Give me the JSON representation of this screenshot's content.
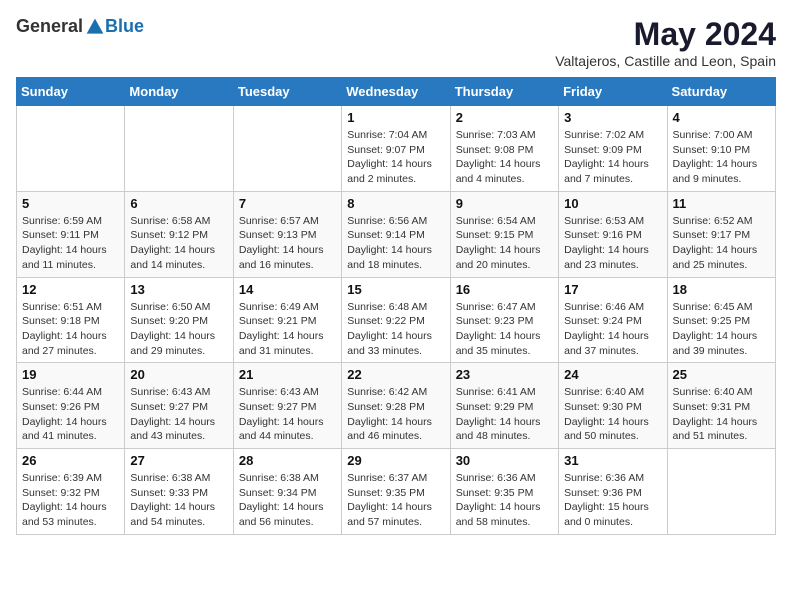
{
  "header": {
    "logo_general": "General",
    "logo_blue": "Blue",
    "month_year": "May 2024",
    "location": "Valtajeros, Castille and Leon, Spain"
  },
  "days_of_week": [
    "Sunday",
    "Monday",
    "Tuesday",
    "Wednesday",
    "Thursday",
    "Friday",
    "Saturday"
  ],
  "weeks": [
    [
      {
        "day": "",
        "info": ""
      },
      {
        "day": "",
        "info": ""
      },
      {
        "day": "",
        "info": ""
      },
      {
        "day": "1",
        "info": "Sunrise: 7:04 AM\nSunset: 9:07 PM\nDaylight: 14 hours\nand 2 minutes."
      },
      {
        "day": "2",
        "info": "Sunrise: 7:03 AM\nSunset: 9:08 PM\nDaylight: 14 hours\nand 4 minutes."
      },
      {
        "day": "3",
        "info": "Sunrise: 7:02 AM\nSunset: 9:09 PM\nDaylight: 14 hours\nand 7 minutes."
      },
      {
        "day": "4",
        "info": "Sunrise: 7:00 AM\nSunset: 9:10 PM\nDaylight: 14 hours\nand 9 minutes."
      }
    ],
    [
      {
        "day": "5",
        "info": "Sunrise: 6:59 AM\nSunset: 9:11 PM\nDaylight: 14 hours\nand 11 minutes."
      },
      {
        "day": "6",
        "info": "Sunrise: 6:58 AM\nSunset: 9:12 PM\nDaylight: 14 hours\nand 14 minutes."
      },
      {
        "day": "7",
        "info": "Sunrise: 6:57 AM\nSunset: 9:13 PM\nDaylight: 14 hours\nand 16 minutes."
      },
      {
        "day": "8",
        "info": "Sunrise: 6:56 AM\nSunset: 9:14 PM\nDaylight: 14 hours\nand 18 minutes."
      },
      {
        "day": "9",
        "info": "Sunrise: 6:54 AM\nSunset: 9:15 PM\nDaylight: 14 hours\nand 20 minutes."
      },
      {
        "day": "10",
        "info": "Sunrise: 6:53 AM\nSunset: 9:16 PM\nDaylight: 14 hours\nand 23 minutes."
      },
      {
        "day": "11",
        "info": "Sunrise: 6:52 AM\nSunset: 9:17 PM\nDaylight: 14 hours\nand 25 minutes."
      }
    ],
    [
      {
        "day": "12",
        "info": "Sunrise: 6:51 AM\nSunset: 9:18 PM\nDaylight: 14 hours\nand 27 minutes."
      },
      {
        "day": "13",
        "info": "Sunrise: 6:50 AM\nSunset: 9:20 PM\nDaylight: 14 hours\nand 29 minutes."
      },
      {
        "day": "14",
        "info": "Sunrise: 6:49 AM\nSunset: 9:21 PM\nDaylight: 14 hours\nand 31 minutes."
      },
      {
        "day": "15",
        "info": "Sunrise: 6:48 AM\nSunset: 9:22 PM\nDaylight: 14 hours\nand 33 minutes."
      },
      {
        "day": "16",
        "info": "Sunrise: 6:47 AM\nSunset: 9:23 PM\nDaylight: 14 hours\nand 35 minutes."
      },
      {
        "day": "17",
        "info": "Sunrise: 6:46 AM\nSunset: 9:24 PM\nDaylight: 14 hours\nand 37 minutes."
      },
      {
        "day": "18",
        "info": "Sunrise: 6:45 AM\nSunset: 9:25 PM\nDaylight: 14 hours\nand 39 minutes."
      }
    ],
    [
      {
        "day": "19",
        "info": "Sunrise: 6:44 AM\nSunset: 9:26 PM\nDaylight: 14 hours\nand 41 minutes."
      },
      {
        "day": "20",
        "info": "Sunrise: 6:43 AM\nSunset: 9:27 PM\nDaylight: 14 hours\nand 43 minutes."
      },
      {
        "day": "21",
        "info": "Sunrise: 6:43 AM\nSunset: 9:27 PM\nDaylight: 14 hours\nand 44 minutes."
      },
      {
        "day": "22",
        "info": "Sunrise: 6:42 AM\nSunset: 9:28 PM\nDaylight: 14 hours\nand 46 minutes."
      },
      {
        "day": "23",
        "info": "Sunrise: 6:41 AM\nSunset: 9:29 PM\nDaylight: 14 hours\nand 48 minutes."
      },
      {
        "day": "24",
        "info": "Sunrise: 6:40 AM\nSunset: 9:30 PM\nDaylight: 14 hours\nand 50 minutes."
      },
      {
        "day": "25",
        "info": "Sunrise: 6:40 AM\nSunset: 9:31 PM\nDaylight: 14 hours\nand 51 minutes."
      }
    ],
    [
      {
        "day": "26",
        "info": "Sunrise: 6:39 AM\nSunset: 9:32 PM\nDaylight: 14 hours\nand 53 minutes."
      },
      {
        "day": "27",
        "info": "Sunrise: 6:38 AM\nSunset: 9:33 PM\nDaylight: 14 hours\nand 54 minutes."
      },
      {
        "day": "28",
        "info": "Sunrise: 6:38 AM\nSunset: 9:34 PM\nDaylight: 14 hours\nand 56 minutes."
      },
      {
        "day": "29",
        "info": "Sunrise: 6:37 AM\nSunset: 9:35 PM\nDaylight: 14 hours\nand 57 minutes."
      },
      {
        "day": "30",
        "info": "Sunrise: 6:36 AM\nSunset: 9:35 PM\nDaylight: 14 hours\nand 58 minutes."
      },
      {
        "day": "31",
        "info": "Sunrise: 6:36 AM\nSunset: 9:36 PM\nDaylight: 15 hours\nand 0 minutes."
      },
      {
        "day": "",
        "info": ""
      }
    ]
  ]
}
